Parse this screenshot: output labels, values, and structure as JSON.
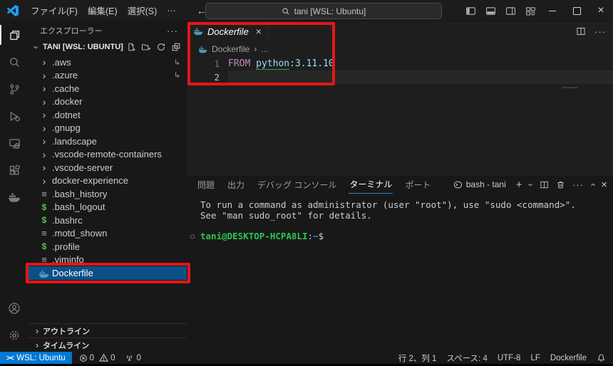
{
  "colors": {
    "brand_blue": "#1f9cf0",
    "remote_badge_blue": "#0078d4",
    "selection_blue": "#0b5086",
    "annotation_red": "#e41616",
    "keyword_pink": "#c586c0",
    "image_name_blue": "#9cdcfe",
    "terminal_green": "#2dc653",
    "terminal_path_blue": "#3b8eea",
    "whale_blue": "#519aba",
    "shell_icon_green": "#54c148"
  },
  "icons": {
    "chevron": "›",
    "more": "···",
    "close": "×",
    "back": "←",
    "forward": "→",
    "symlink": "↳",
    "text_file": "≡",
    "shell_file": "$",
    "plus": "+",
    "prompt_decoration": "○",
    "remote": "><"
  },
  "title_bar": {
    "menus": [
      "ファイル(F)",
      "編集(E)",
      "選択(S)",
      "···"
    ],
    "search_value": "tani [WSL: Ubuntu]"
  },
  "explorer": {
    "title": "エクスプローラー",
    "section": "TANI [WSL: UBUNTU]",
    "items": [
      {
        "label": ".aws",
        "kind": "folder",
        "symlink": true
      },
      {
        "label": ".azure",
        "kind": "folder",
        "symlink": true
      },
      {
        "label": ".cache",
        "kind": "folder"
      },
      {
        "label": ".docker",
        "kind": "folder"
      },
      {
        "label": ".dotnet",
        "kind": "folder"
      },
      {
        "label": ".gnupg",
        "kind": "folder"
      },
      {
        "label": ".landscape",
        "kind": "folder"
      },
      {
        "label": ".vscode-remote-containers",
        "kind": "folder"
      },
      {
        "label": ".vscode-server",
        "kind": "folder"
      },
      {
        "label": "docker-experience",
        "kind": "folder"
      },
      {
        "label": ".bash_history",
        "kind": "text-file"
      },
      {
        "label": ".bash_logout",
        "kind": "shell-file"
      },
      {
        "label": ".bashrc",
        "kind": "shell-file"
      },
      {
        "label": ".motd_shown",
        "kind": "text-file"
      },
      {
        "label": ".profile",
        "kind": "shell-file"
      },
      {
        "label": ".viminfo",
        "kind": "text-file"
      },
      {
        "label": "Dockerfile",
        "kind": "dockerfile",
        "selected": true
      }
    ],
    "bottom_sections": [
      "アウトライン",
      "タイムライン"
    ]
  },
  "editor": {
    "tab_label": "Dockerfile",
    "breadcrumb": {
      "file": "Dockerfile",
      "separator": "›",
      "more": "..."
    },
    "line_numbers": [
      "1",
      "2"
    ],
    "code": {
      "keyword": "FROM",
      "image": "python",
      "colon": ":",
      "tag": "3.11.10"
    }
  },
  "panel": {
    "tabs": [
      "問題",
      "出力",
      "デバッグ コンソール",
      "ターミナル",
      "ポート"
    ],
    "active_tab": "ターミナル",
    "session_label": "bash - tani",
    "terminal_output": [
      "To run a command as administrator (user \"root\"), use \"sudo <command>\".",
      "See \"man sudo_root\" for details."
    ],
    "prompt": {
      "user_host": "tani@DESKTOP-HCPA8LI",
      "colon": ":",
      "path": "~",
      "symbol": "$"
    }
  },
  "status_bar": {
    "remote_label": "WSL: Ubuntu",
    "errors": "0",
    "warnings": "0",
    "ports": "0",
    "line_col": "行 2、列 1",
    "indent": "スペース: 4",
    "encoding": "UTF-8",
    "eol": "LF",
    "language": "Dockerfile"
  }
}
